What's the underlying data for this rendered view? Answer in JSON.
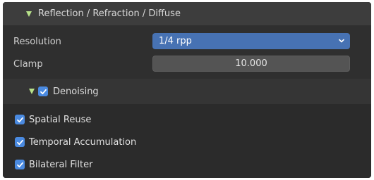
{
  "panel": {
    "title": "Reflection / Refraction / Diffuse",
    "expanded": true
  },
  "properties": {
    "resolution_label": "Resolution",
    "resolution_value": "1/4 rpp",
    "clamp_label": "Clamp",
    "clamp_value": "10.000"
  },
  "denoising": {
    "label": "Denoising",
    "enabled": true,
    "expanded": true,
    "options": [
      {
        "label": "Spatial Reuse",
        "checked": true
      },
      {
        "label": "Temporal Accumulation",
        "checked": true
      },
      {
        "label": "Bilateral Filter",
        "checked": true
      }
    ]
  },
  "colors": {
    "accent": "#4772b3",
    "checkbox": "#4a8ae0",
    "triangle": "#b8e28a",
    "panel_bg": "#2f2f2f"
  }
}
